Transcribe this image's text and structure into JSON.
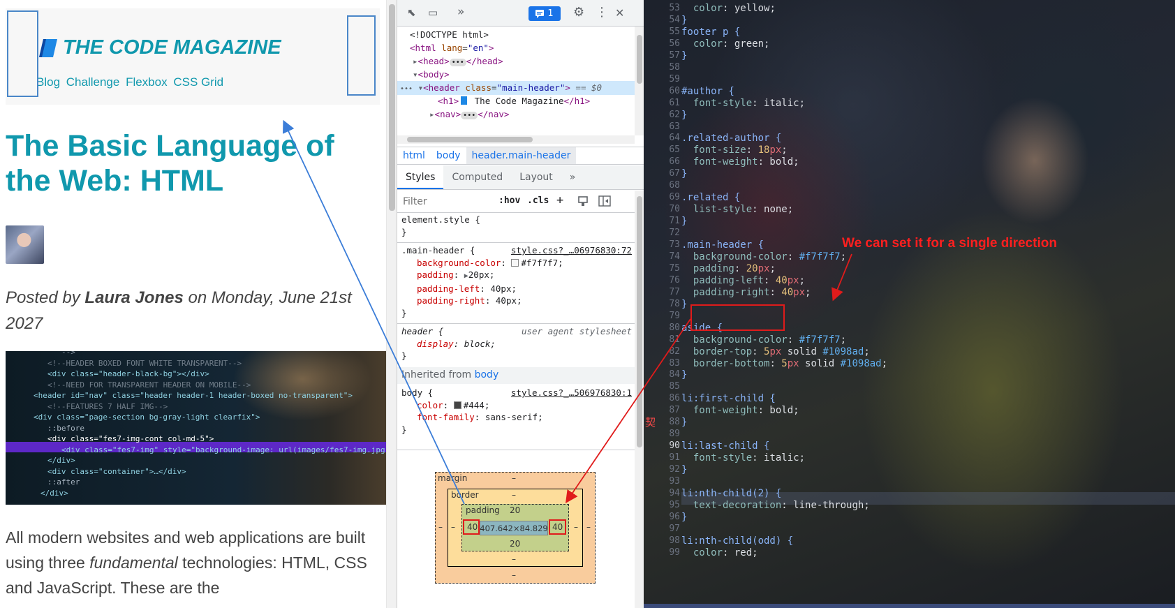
{
  "page": {
    "header": {
      "title": "THE CODE MAGAZINE",
      "nav": [
        "Blog",
        "Challenge",
        "Flexbox",
        "CSS Grid"
      ]
    },
    "h1": "The Basic Language of the Web: HTML",
    "posted": {
      "prefix": "Posted by ",
      "author": "Laura Jones",
      "suffix": " on Monday, June 21st 2027"
    },
    "code_image_lines": [
      "-->",
      "<!--HEADER BOXED FONT WHITE TRANSPARENT-->",
      "<div class=\"header-black-bg\"></div>",
      "<!--NEED FOR TRANSPARENT HEADER ON MOBILE-->",
      "<header id=\"nav\" class=\"header header-1 header-boxed no-transparent\">",
      "<!--FEATURES 7 HALF IMG-->",
      "<div class=\"page-section bg-gray-light clearfix\">",
      "::before",
      "<div class=\"fes7-img-cont col-md-5\">",
      "<div class=\"fes7-img\" style=\"background-image: url(images/fes7-img.jpg)\"></div>",
      "</div>",
      "<div class=\"container\">…</div>",
      "::after",
      "</div>"
    ],
    "body_text": {
      "part1": "All modern websites and web applications are built using three ",
      "emphasis": "fundamental",
      "part2": " technologies: HTML, CSS and JavaScript. These are the"
    }
  },
  "devtools": {
    "toolbar": {
      "inspect": "⬉",
      "device": "▭",
      "more_tabs": "»",
      "issues_count": "1",
      "settings": "⚙",
      "menu": "⋮",
      "close": "✕"
    },
    "dom": {
      "doctype": "<!DOCTYPE html>",
      "html_open": "html",
      "html_attr": "lang",
      "html_val": "\"en\"",
      "head": "head",
      "body": "body",
      "header_tag": "header",
      "header_attr": "class",
      "header_val": "\"main-header\"",
      "header_eq": "== $0",
      "h1_text": "The Code Magazine",
      "nav": "nav"
    },
    "breadcrumb": [
      "html",
      "body",
      "header.main-header"
    ],
    "tabs": [
      "Styles",
      "Computed",
      "Layout",
      "»"
    ],
    "filter_placeholder": "Filter",
    "filter_buttons": [
      ":hov",
      ".cls",
      "+"
    ],
    "rules": {
      "element_style": "element.style {",
      "main_header_selector": ".main-header {",
      "main_header_src": "style.css?_…06976830:72",
      "main_header_props": [
        {
          "name": "background-color",
          "value": "#f7f7f7"
        },
        {
          "name": "padding",
          "value": "20px"
        },
        {
          "name": "padding-left",
          "value": "40px"
        },
        {
          "name": "padding-right",
          "value": "40px"
        }
      ],
      "header_selector": "header {",
      "header_src": "user agent stylesheet",
      "header_prop": {
        "name": "display",
        "value": "block"
      },
      "inherited_label": "Inherited from ",
      "inherited_from": "body",
      "body_selector": "body {",
      "body_src": "style.css?_…506976830:1",
      "body_props": [
        {
          "name": "color",
          "value": "#444"
        },
        {
          "name": "font-family",
          "value": "sans-serif"
        }
      ],
      "close_brace": "}"
    },
    "box_model": {
      "margin_label": "margin",
      "border_label": "border",
      "padding_label": "padding",
      "dash": "–",
      "padding_top": "20",
      "padding_bottom": "20",
      "padding_left": "40",
      "padding_right": "40",
      "content": "407.642×84.829"
    }
  },
  "editor": {
    "first_line": 53,
    "current_line": 90,
    "lines": [
      "  color: yellow;",
      "}",
      "footer p {",
      "  color: green;",
      "}",
      "",
      "",
      "#author {",
      "  font-style: italic;",
      "}",
      "",
      ".related-author {",
      "  font-size: 18px;",
      "  font-weight: bold;",
      "}",
      "",
      ".related {",
      "  list-style: none;",
      "}",
      "",
      ".main-header {",
      "  background-color: #f7f7f7;",
      "  padding: 20px;",
      "  padding-left: 40px;",
      "  padding-right: 40px;",
      "}",
      "",
      "aside {",
      "  background-color: #f7f7f7;",
      "  border-top: 5px solid #1098ad;",
      "  border-bottom: 5px solid #1098ad;",
      "}",
      "",
      "li:first-child {",
      "  font-weight: bold;",
      "}",
      "",
      "li:last-child {",
      "  font-style: italic;",
      "}",
      "",
      "li:nth-child(2) {",
      "  text-decoration: line-through;",
      "}",
      "",
      "li:nth-child(odd) {",
      "  color: red;"
    ],
    "annotation": "We can set it for a single direction",
    "margin_glyph": "契"
  },
  "colors": {
    "accent": "#1098ad",
    "header_bg": "#f7f7f7",
    "annotation_red": "#ff1f1f",
    "arrow_blue": "#3b7dd8"
  }
}
